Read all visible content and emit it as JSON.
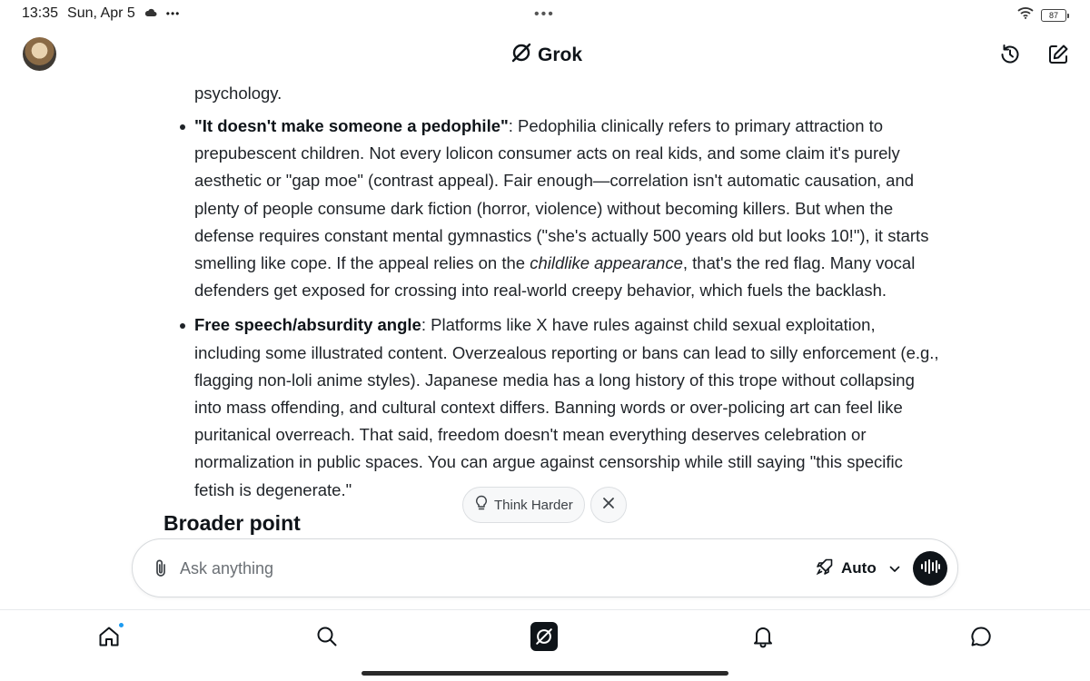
{
  "status_bar": {
    "time": "13:35",
    "date": "Sun, Apr 5",
    "cloud_icon": "cloud-icon",
    "more": "•••",
    "center_dots": "•••",
    "battery": "87"
  },
  "header": {
    "title": "Grok",
    "avatar": "avatar",
    "icons": [
      "history-icon",
      "new-chat-icon"
    ]
  },
  "message": {
    "previous_tail": "psychology.",
    "bullets": [
      {
        "title": "\"It doesn't make someone a pedophile\"",
        "pre": ": Pedophilia clinically refers to primary attraction to prepubescent children. Not every lolicon consumer acts on real kids, and some claim it's purely aesthetic or \"gap moe\" (contrast appeal). Fair enough—correlation isn't automatic causation, and plenty of people consume dark fiction (horror, violence) without becoming killers. But when the defense requires constant mental gymnastics (\"she's actually 500 years old but looks 10!\"), it starts smelling like cope. If the appeal relies on the ",
        "emphasis": "childlike appearance",
        "post": ", that's the red flag. Many vocal defenders get exposed for crossing into real-world creepy behavior, which fuels the backlash."
      },
      {
        "title": "Free speech/absurdity angle",
        "pre": ": Platforms like X have rules against child sexual exploitation, including some illustrated content. Overzealous reporting or bans can lead to silly enforcement (e.g., flagging non-loli anime styles). Japanese media has a long history of this trope without collapsing into mass offending, and cultural context differs. Banning words or over-policing art can feel like puritanical overreach. That said, freedom doesn't mean everything deserves celebration or normalization in public spaces. You can argue against censorship while still saying \"this specific fetish is degenerate.\"",
        "emphasis": "",
        "post": ""
      }
    ],
    "next_heading": "Broader point"
  },
  "chips": {
    "think_harder": "Think Harder"
  },
  "composer": {
    "placeholder": "Ask anything",
    "mode": "Auto"
  },
  "bottom_nav": {
    "items": [
      "home-icon",
      "search-icon",
      "grok-icon",
      "notifications-icon",
      "messages-icon"
    ]
  }
}
